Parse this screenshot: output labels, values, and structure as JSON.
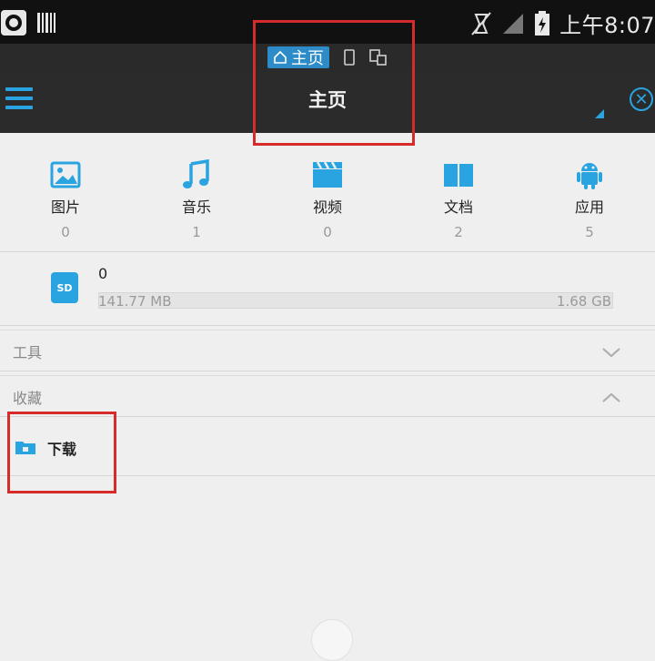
{
  "statusbar": {
    "time": "上午8:07"
  },
  "tabs": {
    "active_label": "主页"
  },
  "toolbar": {
    "title": "主页"
  },
  "categories": [
    {
      "label": "图片",
      "count": "0",
      "icon": "image-icon"
    },
    {
      "label": "音乐",
      "count": "1",
      "icon": "music-note-icon"
    },
    {
      "label": "视频",
      "count": "0",
      "icon": "film-icon"
    },
    {
      "label": "文档",
      "count": "2",
      "icon": "book-icon"
    },
    {
      "label": "应用",
      "count": "5",
      "icon": "android-icon"
    }
  ],
  "storage": {
    "name": "0",
    "used": "141.77 MB",
    "total": "1.68 GB",
    "icon_label": "SD"
  },
  "sections": {
    "tools": {
      "title": "工具"
    },
    "favorites": {
      "title": "收藏"
    }
  },
  "bookmarks": [
    {
      "label": "下载",
      "icon": "download-folder-icon"
    }
  ],
  "colors": {
    "accent": "#2aa4e0",
    "annotation": "#d62b2b",
    "toolbar": "#2b2b2b"
  }
}
